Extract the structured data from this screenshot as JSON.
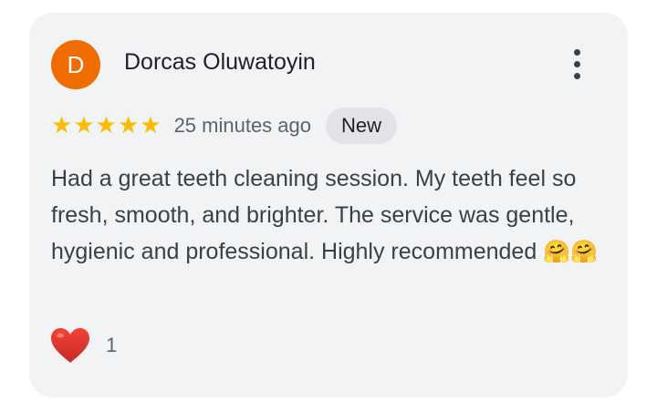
{
  "review": {
    "avatar_letter": "D",
    "avatar_color": "#ef6c00",
    "author": "Dorcas Oluwatoyin",
    "menu_icon": "more-vert-icon",
    "rating": 5,
    "star_glyph": "★",
    "star_color": "#fbbc04",
    "time": "25 minutes ago",
    "badge": "New",
    "text": "Had a great teeth cleaning session. My teeth feel so fresh, smooth, and brighter. The service was gentle, hygienic and professional. Highly recommended",
    "text_emojis": [
      "🤗",
      "🤗"
    ],
    "reaction": {
      "icon": "heart-icon",
      "color": "#e53935",
      "count": "1"
    }
  }
}
